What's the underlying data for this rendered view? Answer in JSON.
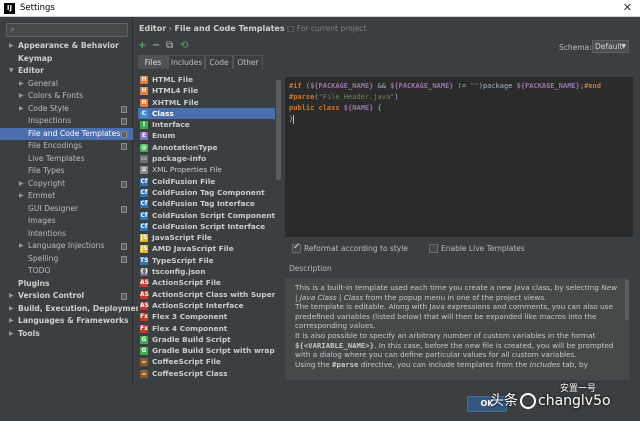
{
  "window": {
    "title": "Settings",
    "app_icon": "IJ"
  },
  "tree": {
    "items": [
      {
        "label": "Appearance & Behavior",
        "level": 0,
        "bold": true,
        "arrow": "▶"
      },
      {
        "label": "Keymap",
        "level": 0,
        "bold": true,
        "arrow": ""
      },
      {
        "label": "Editor",
        "level": 0,
        "bold": true,
        "arrow": "▼"
      },
      {
        "label": "General",
        "level": 1,
        "arrow": "▶"
      },
      {
        "label": "Colors & Fonts",
        "level": 1,
        "arrow": "▶"
      },
      {
        "label": "Code Style",
        "level": 1,
        "arrow": "▶",
        "project": true
      },
      {
        "label": "Inspections",
        "level": 1,
        "arrow": "",
        "project": true
      },
      {
        "label": "File and Code Templates",
        "level": 1,
        "arrow": "",
        "project": true,
        "selected": true
      },
      {
        "label": "File Encodings",
        "level": 1,
        "arrow": "",
        "project": true
      },
      {
        "label": "Live Templates",
        "level": 1,
        "arrow": ""
      },
      {
        "label": "File Types",
        "level": 1,
        "arrow": ""
      },
      {
        "label": "Copyright",
        "level": 1,
        "arrow": "▶",
        "project": true
      },
      {
        "label": "Emmet",
        "level": 1,
        "arrow": "▶"
      },
      {
        "label": "GUI Designer",
        "level": 1,
        "arrow": "",
        "project": true
      },
      {
        "label": "Images",
        "level": 1,
        "arrow": ""
      },
      {
        "label": "Intentions",
        "level": 1,
        "arrow": ""
      },
      {
        "label": "Language Injections",
        "level": 1,
        "arrow": "▶",
        "project": true
      },
      {
        "label": "Spelling",
        "level": 1,
        "arrow": "",
        "project": true
      },
      {
        "label": "TODO",
        "level": 1,
        "arrow": ""
      },
      {
        "label": "Plugins",
        "level": 0,
        "bold": true,
        "arrow": ""
      },
      {
        "label": "Version Control",
        "level": 0,
        "bold": true,
        "arrow": "▶",
        "project": true
      },
      {
        "label": "Build, Execution, Deployment",
        "level": 0,
        "bold": true,
        "arrow": "▶"
      },
      {
        "label": "Languages & Frameworks",
        "level": 0,
        "bold": true,
        "arrow": "▶"
      },
      {
        "label": "Tools",
        "level": 0,
        "bold": true,
        "arrow": "▶"
      }
    ]
  },
  "breadcrumb": {
    "parent": "Editor",
    "separator": "›",
    "current": "File and Code Templates",
    "note": "For current project"
  },
  "toolbar": {
    "add": "+",
    "remove": "−",
    "copy": "⧉",
    "reset": "⟲"
  },
  "schema": {
    "label": "Schema:",
    "value": "Default"
  },
  "tabs": [
    "Files",
    "Includes",
    "Code",
    "Other"
  ],
  "templates": [
    {
      "label": "HTML File",
      "icon": "H",
      "color": "#e07b39"
    },
    {
      "label": "HTML4 File",
      "icon": "H",
      "color": "#e07b39"
    },
    {
      "label": "XHTML File",
      "icon": "H",
      "color": "#e07b39"
    },
    {
      "label": "Class",
      "icon": "C",
      "color": "#3d8fd6",
      "selected": true
    },
    {
      "label": "Interface",
      "icon": "I",
      "color": "#3dae4f"
    },
    {
      "label": "Enum",
      "icon": "E",
      "color": "#8b6ec7"
    },
    {
      "label": "AnnotationType",
      "icon": "@",
      "color": "#3dae4f"
    },
    {
      "label": "package-info",
      "icon": "▭",
      "color": "#6b7078"
    },
    {
      "label": "XML Properties File",
      "icon": "≡",
      "color": "#8a8a8a",
      "normal": true
    },
    {
      "label": "ColdFusion File",
      "icon": "Cf",
      "color": "#2e75b6"
    },
    {
      "label": "ColdFusion Tag Component",
      "icon": "Cf",
      "color": "#2e75b6"
    },
    {
      "label": "ColdFusion Tag Interface",
      "icon": "Cf",
      "color": "#2e75b6"
    },
    {
      "label": "ColdFusion Script Component",
      "icon": "Cf",
      "color": "#2e75b6"
    },
    {
      "label": "ColdFusion Script Interface",
      "icon": "Cf",
      "color": "#2e75b6"
    },
    {
      "label": "JavaScript File",
      "icon": "JS",
      "color": "#d4b72a"
    },
    {
      "label": "AMD JavaScript File",
      "icon": "JS",
      "color": "#d4b72a"
    },
    {
      "label": "TypeScript File",
      "icon": "TS",
      "color": "#2e75b6"
    },
    {
      "label": "tsconfig.json",
      "icon": "{}",
      "color": "#6b7078"
    },
    {
      "label": "ActionScript File",
      "icon": "AS",
      "color": "#c0392b"
    },
    {
      "label": "ActionScript Class with Supers",
      "icon": "AS",
      "color": "#c0392b"
    },
    {
      "label": "ActionScript Interface",
      "icon": "AS",
      "color": "#c0392b"
    },
    {
      "label": "Flex 3 Component",
      "icon": "Fx",
      "color": "#c0392b"
    },
    {
      "label": "Flex 4 Component",
      "icon": "Fx",
      "color": "#c0392b"
    },
    {
      "label": "Gradle Build Script",
      "icon": "G",
      "color": "#3dae4f"
    },
    {
      "label": "Gradle Build Script with wrapper",
      "icon": "G",
      "color": "#3dae4f"
    },
    {
      "label": "CoffeeScript File",
      "icon": "☕",
      "color": "#8b5a2b"
    },
    {
      "label": "CoffeeScript Class",
      "icon": "☕",
      "color": "#8b5a2b"
    }
  ],
  "editor": {
    "line1": {
      "if": "#if",
      "open": " (",
      "v1": "${PACKAGE_NAME}",
      "amp": " && ",
      "v2": "${PACKAGE_NAME}",
      "neq": " != ",
      "s": "\"\"",
      "close": ")package ",
      "v3": "${PACKAGE_NAME}",
      "semi": ";",
      "end": "#end"
    },
    "line2": {
      "parse": "#parse",
      "open": "(",
      "s": "\"File Header.java\"",
      "close": ")"
    },
    "line3": {
      "pre": "public class ",
      "v": "${NAME}",
      "post": " {"
    },
    "line4": "}"
  },
  "options": {
    "reformat": "Reformat according to style",
    "live": "Enable Live Templates"
  },
  "description": {
    "label": "Description",
    "p1a": "This is a built-in template used each time you create a new Java class, by selecting",
    "p1b": "New | Java Class | Class",
    "p1c": " from the popup menu in one of the project views.",
    "p2": "The template is editable. Along with Java expressions and comments, you can also use predefined variables (listed below) that will then be expanded like macros into the corresponding values.",
    "p3a": "It is also possible to specify an arbitrary number of custom variables in the format ",
    "p3b": "${<VARIABLE_NAME>}",
    "p3c": ". In this case, before the new file is created, you will be prompted with a dialog where you can define particular values for all custom variables.",
    "p4a": "Using the ",
    "p4b": "#parse",
    "p4c": " directive, you can include templates from the ",
    "p4d": "Includes",
    "p4e": " tab, by"
  },
  "footer": {
    "ok": "OK"
  },
  "watermark": {
    "text1": "头条",
    "text2": "changlv5o",
    "text3": "安置一号"
  }
}
